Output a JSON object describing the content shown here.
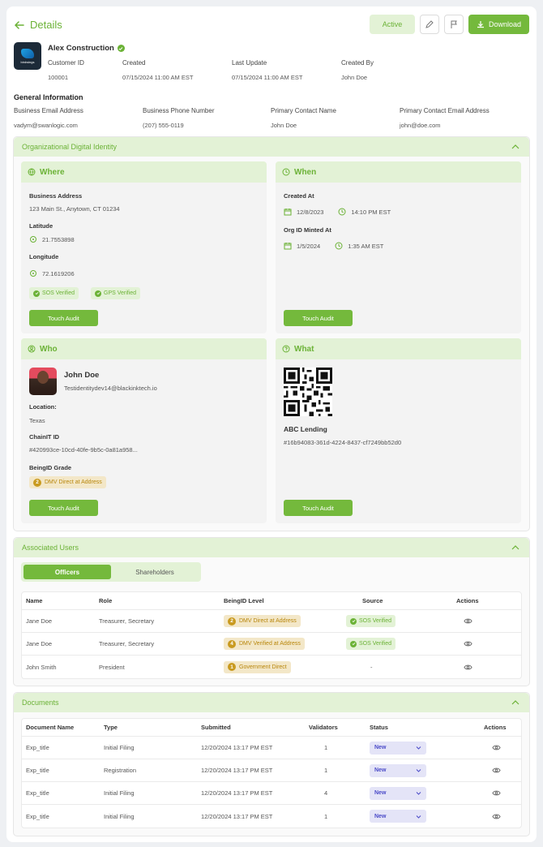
{
  "header": {
    "back_label": "Details",
    "status": "Active",
    "download_label": "Download"
  },
  "company": {
    "logo_text": "birdwings",
    "name": "Alex Construction",
    "meta": [
      {
        "label": "Customer ID",
        "value": "100001"
      },
      {
        "label": "Created",
        "value": "07/15/2024 11:00 AM EST"
      },
      {
        "label": "Last Update",
        "value": "07/15/2024 11:00 AM EST"
      },
      {
        "label": "Created By",
        "value": "John Doe"
      }
    ]
  },
  "general": {
    "title": "General Information",
    "fields": [
      {
        "label": "Business Email Address",
        "value": "vadym@swanlogic.com"
      },
      {
        "label": "Business Phone Number",
        "value": "(207) 555-0119"
      },
      {
        "label": "Primary Contact Name",
        "value": "John Doe"
      },
      {
        "label": "Primary Contact Email Address",
        "value": "john@doe.com"
      }
    ]
  },
  "odi": {
    "title": "Organizational Digital Identity",
    "where": {
      "title": "Where",
      "address_label": "Business Address",
      "address": "123 Main St., Anytown, CT 01234",
      "lat_label": "Latitude",
      "lat": "21.7553898",
      "lng_label": "Longitude",
      "lng": "72.1619206",
      "tag1": "SOS Verified",
      "tag2": "GPS Verified",
      "audit": "Touch Audit"
    },
    "when": {
      "title": "When",
      "created_label": "Created At",
      "created_date": "12/8/2023",
      "created_time": "14:10 PM EST",
      "minted_label": "Org ID Minted At",
      "minted_date": "1/5/2024",
      "minted_time": "1:35 AM EST",
      "audit": "Touch Audit"
    },
    "who": {
      "title": "Who",
      "name": "John Doe",
      "email": "Testidentitydev14@blackinktech.io",
      "loc_label": "Location:",
      "loc": "Texas",
      "chain_label": "ChainIT ID",
      "chain": "#420993ce-10cd-40fe-9b5c-0a81a958...",
      "grade_label": "BeingID Grade",
      "grade_num": "2",
      "grade": "DMV Direct at Address",
      "audit": "Touch Audit"
    },
    "what": {
      "title": "What",
      "name": "ABC Lending",
      "hash": "#16b94083-361d-4224-8437-cf7249bb52d0",
      "audit": "Touch Audit"
    }
  },
  "users": {
    "title": "Associated Users",
    "tabs": [
      "Officers",
      "Shareholders"
    ],
    "headers": [
      "Name",
      "Role",
      "BeingID Level",
      "Source",
      "Actions"
    ],
    "rows": [
      {
        "name": "Jane Doe",
        "role": "Treasurer, Secretary",
        "level_num": "2",
        "level": "DMV Direct at Address",
        "source": "SOS Verified"
      },
      {
        "name": "Jane Doe",
        "role": "Treasurer, Secretary",
        "level_num": "4",
        "level": "DMV Verified at Address",
        "source": "SOS Verified"
      },
      {
        "name": "John Smith",
        "role": "President",
        "level_num": "1",
        "level": "Government Direct",
        "source": "-"
      }
    ]
  },
  "documents": {
    "title": "Documents",
    "headers": [
      "Document Name",
      "Type",
      "Submitted",
      "Validators",
      "Status",
      "Actions"
    ],
    "rows": [
      {
        "name": "Exp_title",
        "type": "Initial Filing",
        "submitted": "12/20/2024 13:17 PM EST",
        "validators": "1",
        "status": "New"
      },
      {
        "name": "Exp_title",
        "type": "Registration",
        "submitted": "12/20/2024 13:17 PM EST",
        "validators": "1",
        "status": "New"
      },
      {
        "name": "Exp_title",
        "type": "Initial Filing",
        "submitted": "12/20/2024 13:17 PM EST",
        "validators": "4",
        "status": "New"
      },
      {
        "name": "Exp_title",
        "type": "Initial Filing",
        "submitted": "12/20/2024 13:17 PM EST",
        "validators": "1",
        "status": "New"
      }
    ]
  },
  "colors": {
    "accent": "#74b93c",
    "accent_light": "#e3f2d6",
    "gold": "#c99a1f",
    "status_select": "#e4e4f7"
  }
}
